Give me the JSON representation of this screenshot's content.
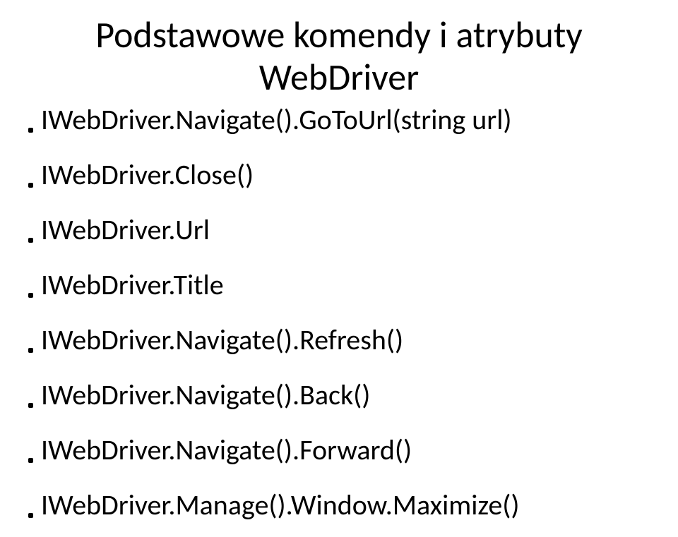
{
  "title_line1": "Podstawowe komendy i atrybuty",
  "title_line2": "WebDriver",
  "items": [
    "IWebDriver.Navigate().GoToUrl(string url)",
    "IWebDriver.Close()",
    "IWebDriver.Url",
    "IWebDriver.Title",
    "IWebDriver.Navigate().Refresh()",
    "IWebDriver.Navigate().Back()",
    "IWebDriver.Navigate().Forward()",
    "IWebDriver.Manage().Window.Maximize()"
  ]
}
